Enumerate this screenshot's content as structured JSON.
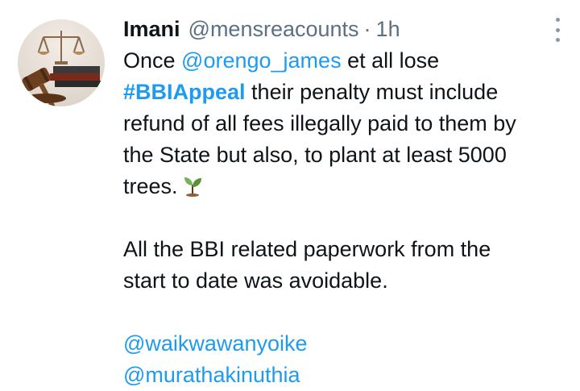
{
  "tweet": {
    "author_name": "Imani",
    "author_handle": "@mensreacounts",
    "separator": "·",
    "time": "1h",
    "avatar_icon": "scales-of-justice-gavel-icon",
    "more_icon": "more-vertical-icon",
    "mention_1": "@orengo_james",
    "hashtag": "#BBIAppeal",
    "text_1a": "Once ",
    "text_1b": " et all lose",
    "text_2": " their penalty must include",
    "text_3": "refund of all fees illegally paid to them by",
    "text_4": "the State but also, to plant at least 5000",
    "text_5": "trees.",
    "emoji": "seedling-icon",
    "para_2_line_1": "All the BBI related paperwork from the",
    "para_2_line_2": "start to date was avoidable.",
    "mention_2": "@waikwawanyoike",
    "mention_3": "@murathakinuthia"
  },
  "colors": {
    "link": "#1d9bf0",
    "text": "#0f1419",
    "secondary": "#5b7083"
  }
}
